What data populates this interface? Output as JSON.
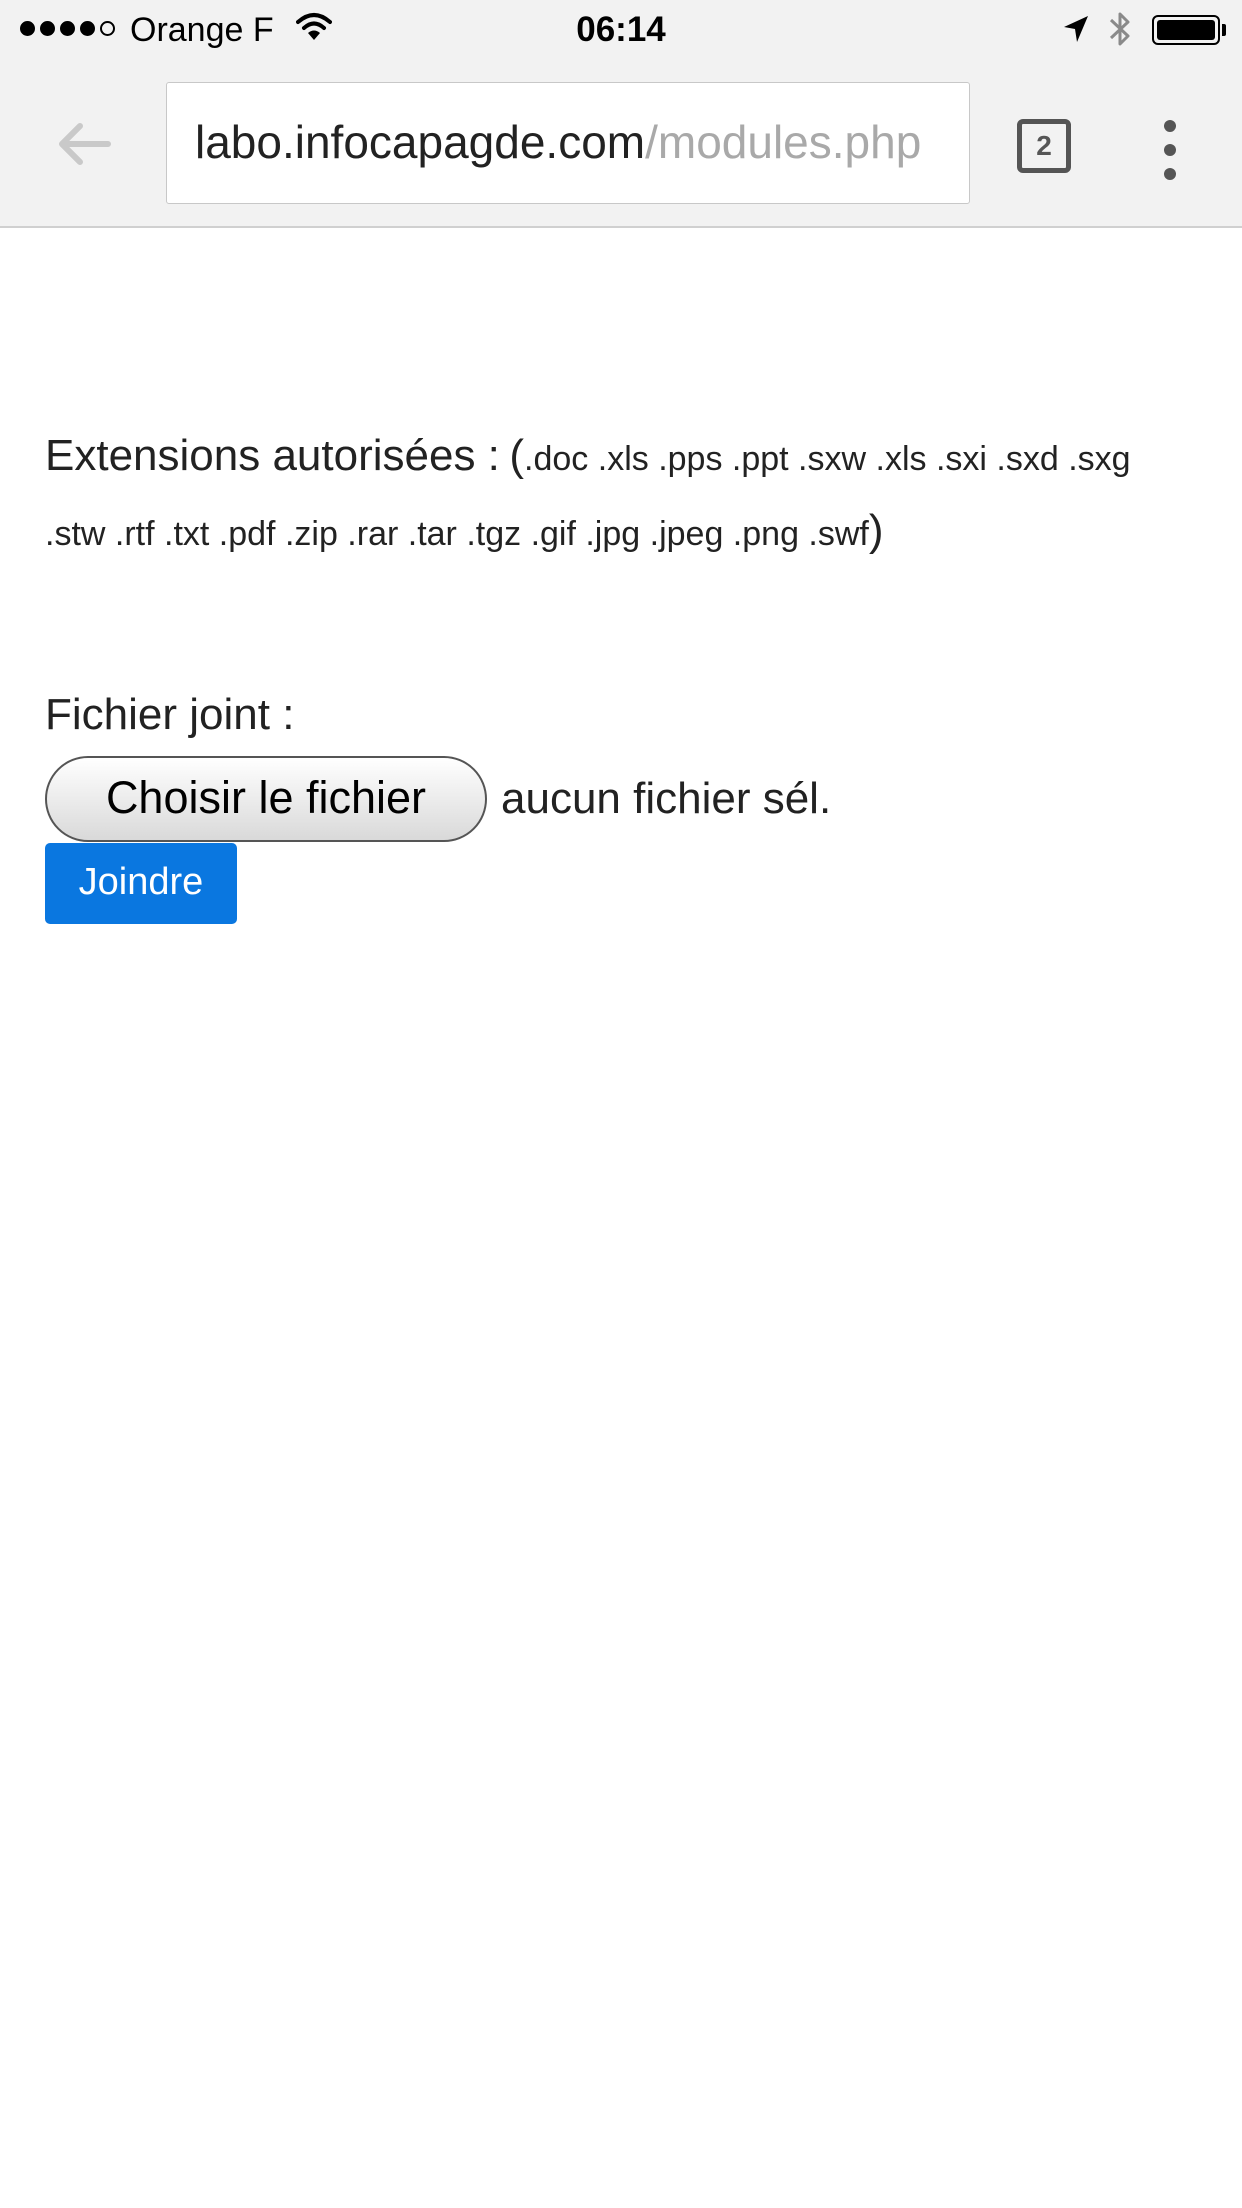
{
  "status_bar": {
    "carrier": "Orange F",
    "time": "06:14",
    "signal_bars_filled": 4,
    "signal_bars_total": 5,
    "battery_level": 1.0
  },
  "browser": {
    "url_host": "labo.infocapagde.com",
    "url_path": "/modules.php",
    "tab_count": "2",
    "icons": {
      "back": "arrow-left-icon",
      "menu": "vertical-dots-menu-icon",
      "tabs": "tab-switcher-icon"
    }
  },
  "page": {
    "extensions_label": "Extensions autorisées :",
    "extensions_open": "(",
    "extensions_list": ".doc .xls .pps .ppt .sxw .xls .sxi .sxd .sxg .stw .rtf .txt .pdf .zip .rar .tar .tgz .gif .jpg .jpeg .png .swf",
    "extensions_close": ")",
    "field_label": "Fichier joint :",
    "choose_file_button": "Choisir le fichier",
    "no_file_text": "aucun fichier sél.",
    "submit_button": "Joindre",
    "colors": {
      "submit_background": "#0a77e0",
      "toolbar_background": "#f2f2f2"
    }
  }
}
